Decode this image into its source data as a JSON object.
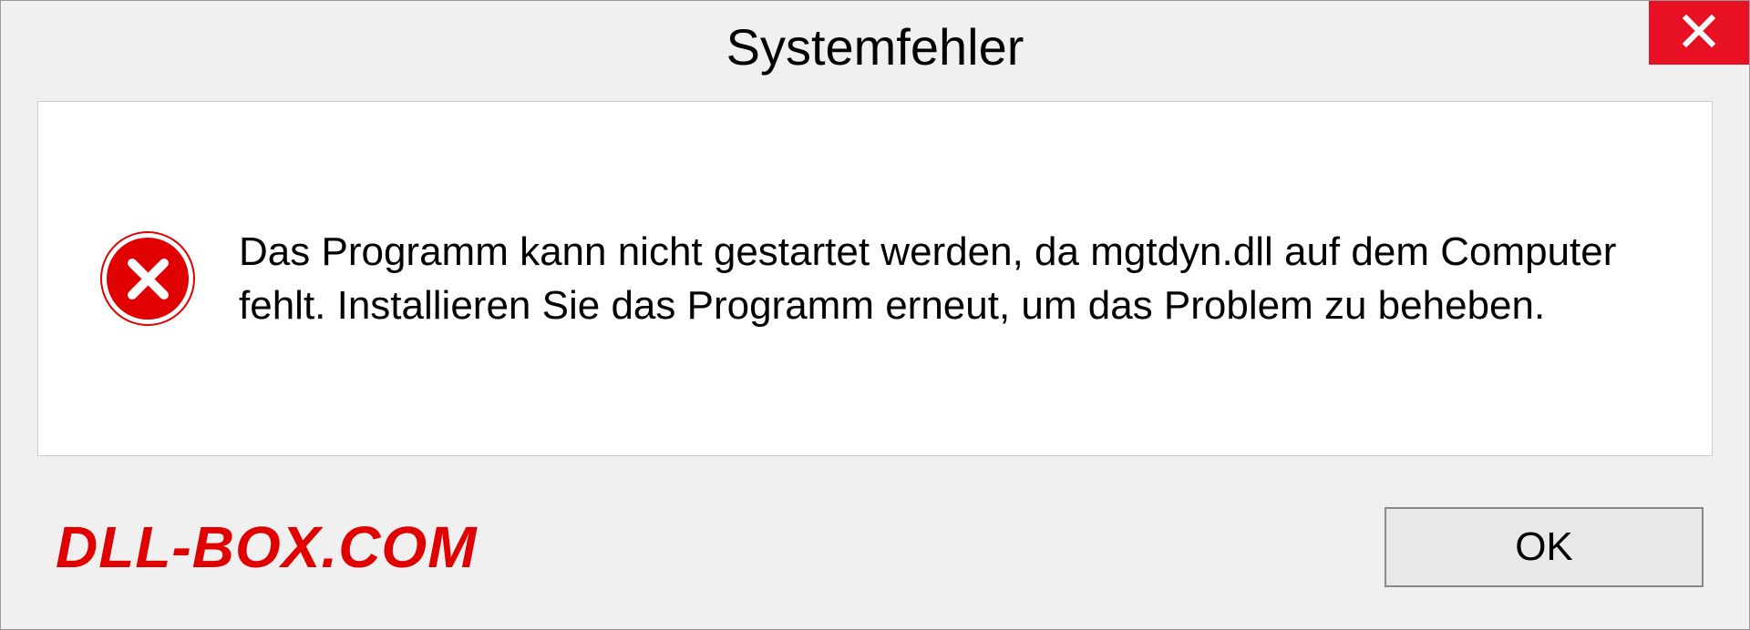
{
  "dialog": {
    "title": "Systemfehler",
    "message": "Das Programm kann nicht gestartet werden, da mgtdyn.dll auf dem Computer fehlt. Installieren Sie das Programm erneut, um das Problem zu beheben.",
    "ok_label": "OK"
  },
  "watermark": "DLL-BOX.COM"
}
